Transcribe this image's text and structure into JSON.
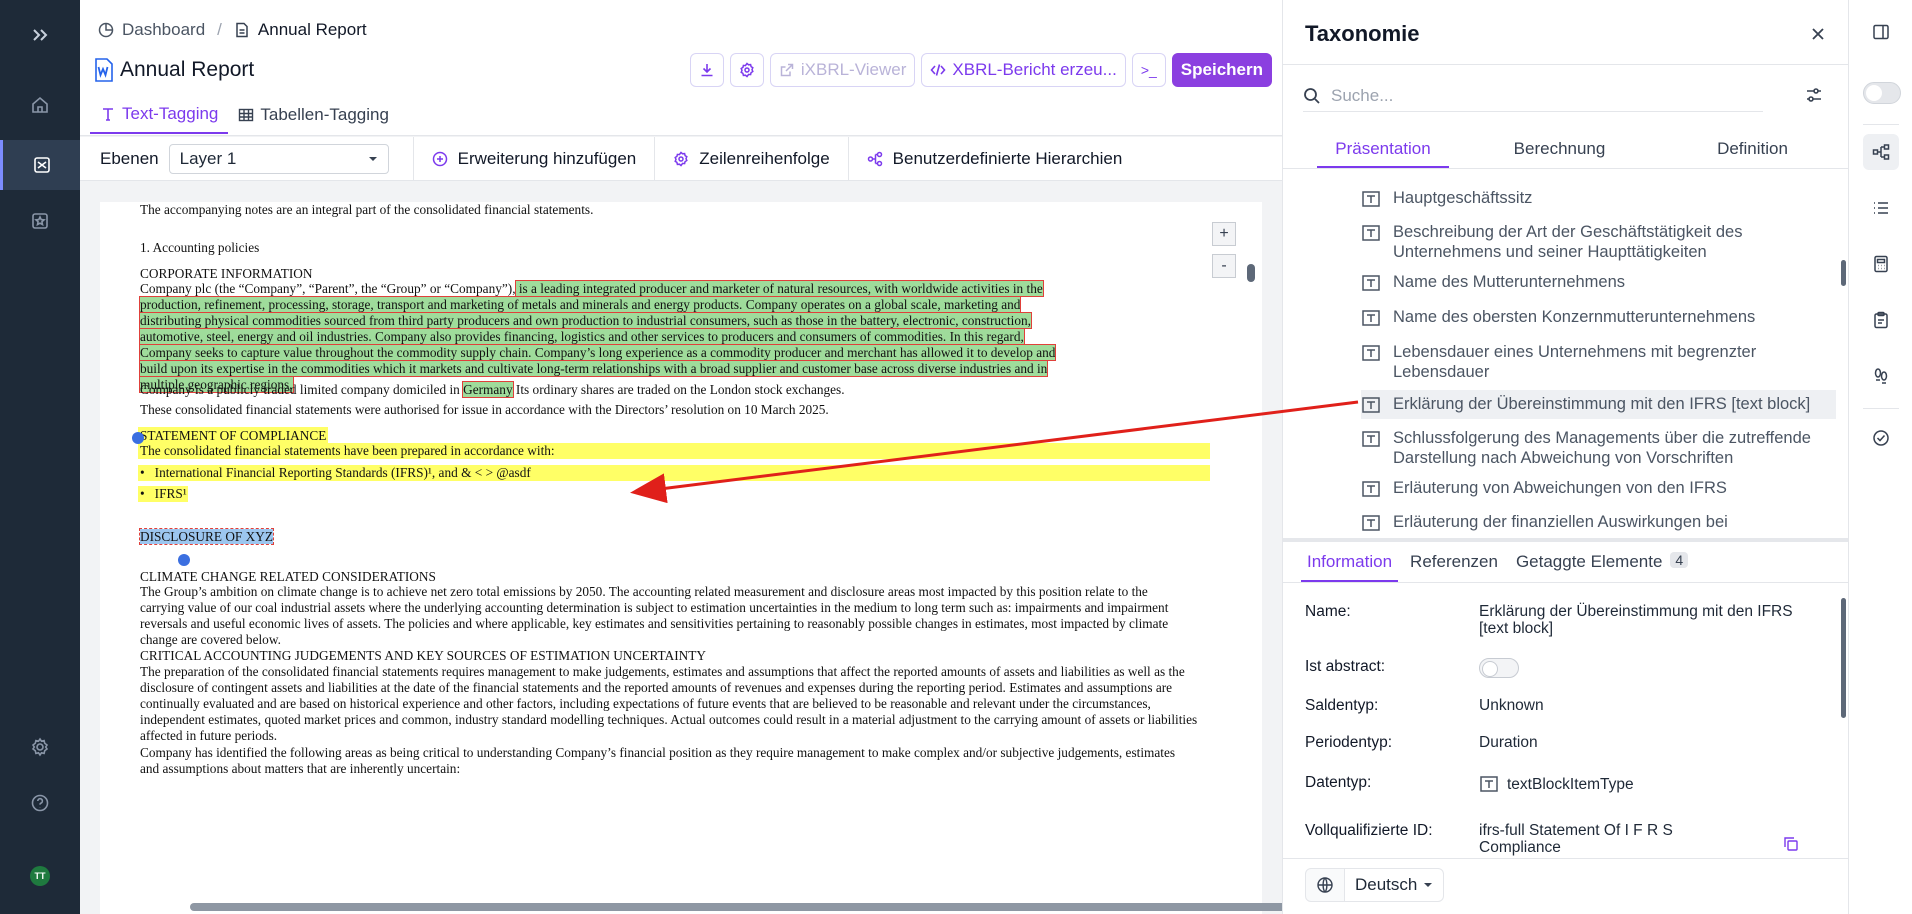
{
  "breadcrumb": {
    "dashboard": "Dashboard",
    "separator": "/",
    "current": "Annual Report"
  },
  "document": {
    "title": "Annual Report"
  },
  "toolbar": {
    "ixbrl_viewer": "iXBRL-Viewer",
    "xbrl_report": "XBRL-Bericht erzeu...",
    "terminal": ">_",
    "save": "Speichern"
  },
  "tabs": {
    "text_tagging": "Text-Tagging",
    "table_tagging": "Tabellen-Tagging"
  },
  "subbar": {
    "layers_label": "Ebenen",
    "layer_value": "Layer 1",
    "add_extension": "Erweiterung hinzufügen",
    "row_order": "Zeilenreihenfolge",
    "custom_hierarchies": "Benutzerdefinierte Hierarchien"
  },
  "doc": {
    "line1": "The accompanying notes are an integral part of the consolidated financial statements.",
    "h_accounting": "1. Accounting policies",
    "h_corporate": "CORPORATE INFORMATION",
    "corp_pre": "Company plc (the “Company”, “Parent”, the “Group” or “Company”),",
    "corp_tag1": " is a leading integrated producer and marketer of natural resources, with worldwide activities in the",
    "corp_tag2": "production, refinement, processing, storage, transport and marketing of metals and minerals and energy products. Company operates on a global scale, marketing and",
    "corp_tag3": "distributing physical commodities sourced from third party producers and own production to industrial consumers, such as those in the battery, electronic, construction,",
    "corp_tag4": "automotive, steel, energy and oil industries. Company also provides financing, logistics and other services to producers and consumers of commodities. In this regard,",
    "corp_tag5": "Company seeks to capture value throughout the commodity supply chain. Company’s long experience as a commodity producer and merchant has allowed it to develop and",
    "corp_tag6": "build upon its expertise in the commodities which it markets and cultivate long-term relationships with a broad supplier and customer base across diverse industries and in",
    "corp_tag7": "multiple geographic regions.",
    "domicile_pre": "Company is a publicly traded limited company domiciled in ",
    "domicile_tag": "Germany",
    "domicile_post": " Its ordinary shares are traded on the London stock exchanges.",
    "authorised": "These consolidated financial statements were authorised for issue in accordance with the Directors’ resolution on 10 March 2025.",
    "h_compliance": "STATEMENT OF COMPLIANCE",
    "compliance_line": "The consolidated financial statements have been prepared in accordance with:",
    "bullet1": "International Financial Reporting Standards (IFRS)¹, and & < > @asdf",
    "bullet2": "IFRS¹",
    "bullet_mark": "•",
    "h_disclosure": "DISCLOSURE OF XYZ",
    "h_climate": "CLIMATE CHANGE RELATED CONSIDERATIONS",
    "climate_p": "The Group’s ambition on climate change is to achieve net zero total emissions by 2050. The accounting related measurement and disclosure areas most impacted by this position relate to the carrying value of our coal industrial assets where the underlying accounting determination is subject to estimation uncertainties in the medium to long term such as: impairments and impairment reversals and useful economic lives of assets. The policies and where applicable, key estimates and sensitivities pertaining to reasonably possible changes in estimates, most impacted by climate change are covered below.",
    "h_critical": "CRITICAL ACCOUNTING JUDGEMENTS AND KEY SOURCES OF ESTIMATION UNCERTAINTY",
    "critical_p": "The preparation of the consolidated financial statements requires management to make judgements, estimates and assumptions that affect the reported amounts of assets and liabilities as well as the disclosure of contingent assets and liabilities at the date of the financial statements and the reported amounts of revenues and expenses during the reporting period. Estimates and assumptions are continually evaluated and are based on historical experience and other factors, including expectations of future events that are believed to be reasonable and relevant under the circumstances, independent estimates, quoted market prices and common, industry standard modelling techniques. Actual outcomes could result in a material adjustment to the carrying amount of assets or liabilities affected in future periods.",
    "identified_p": "Company has identified the following areas as being critical to understanding Company’s financial position as they require management to make complex and/or subjective judgements, estimates and assumptions about matters that are inherently uncertain:",
    "zoom_in": "+",
    "zoom_out": "-"
  },
  "panel": {
    "title": "Taxonomie",
    "search_placeholder": "Suche...",
    "tabs": [
      "Präsentation",
      "Berechnung",
      "Definition"
    ],
    "tree": [
      "Hauptgeschäftssitz",
      "Beschreibung der Art der Geschäftstätigkeit des Unternehmens und seiner Haupttätigkeiten",
      "Name des Mutterunternehmens",
      "Name des obersten Konzernmutterunternehmens",
      "Lebensdauer eines Unternehmens mit begrenzter Lebensdauer",
      "Erklärung der Übereinstimmung mit den IFRS [text block]",
      "Schlussfolgerung des Managements über die zutreffende Darstellung nach Abweichung von Vorschriften",
      "Erläuterung von Abweichungen von den IFRS",
      "Erläuterung der finanziellen Auswirkungen bei"
    ],
    "info_tabs": {
      "information": "Information",
      "references": "Referenzen",
      "tagged": "Getaggte Elemente",
      "tagged_count": "4"
    },
    "info": {
      "name_k": "Name:",
      "name_v": "Erklärung der Übereinstimmung mit den IFRS [text block]",
      "abstract_k": "Ist abstract:",
      "balance_k": "Saldentyp:",
      "balance_v": "Unknown",
      "period_k": "Periodentyp:",
      "period_v": "Duration",
      "dtype_k": "Datentyp:",
      "dtype_v": "textBlockItemType",
      "qid_k": "Vollqualifizierte ID:",
      "qid_v": "ifrs-full Statement Of I F R S Compliance"
    },
    "language": "Deutsch"
  },
  "colors": {
    "accent": "#7c3aed",
    "nav_bg": "#1e2a38",
    "tag_green": "#9fdc9b",
    "tag_yellow": "#ffff66",
    "arrow": "#e0201a"
  }
}
